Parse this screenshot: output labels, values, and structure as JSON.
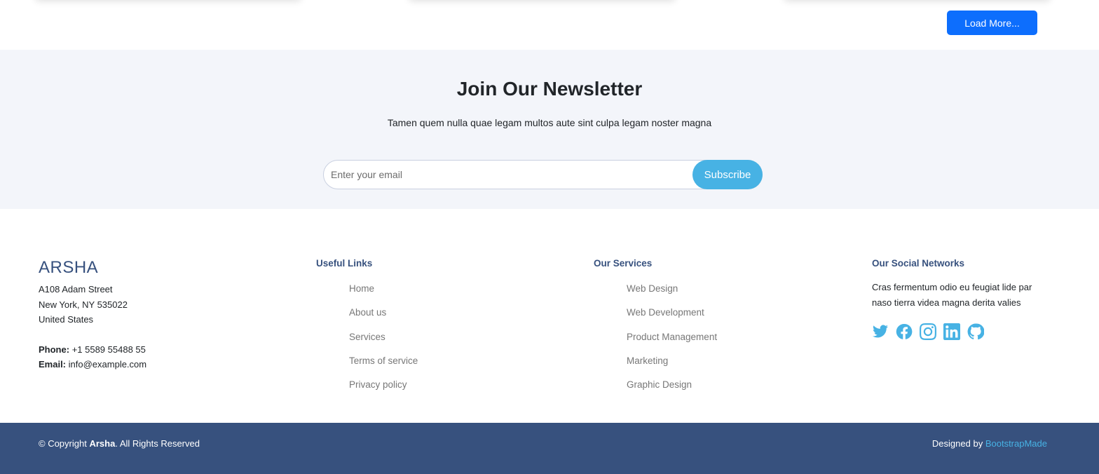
{
  "load_more": {
    "label": "Load More..."
  },
  "newsletter": {
    "title": "Join Our Newsletter",
    "subtitle": "Tamen quem nulla quae legam multos aute sint culpa legam noster magna",
    "email_placeholder": "Enter your email",
    "subscribe_label": "Subscribe"
  },
  "footer": {
    "brand": "ARSHA",
    "address": [
      "A108 Adam Street",
      "New York, NY 535022",
      "United States"
    ],
    "phone_label": "Phone:",
    "phone": "+1 5589 55488 55",
    "email_label": "Email:",
    "email": "info@example.com",
    "useful_links": {
      "title": "Useful Links",
      "items": [
        "Home",
        "About us",
        "Services",
        "Terms of service",
        "Privacy policy"
      ]
    },
    "services": {
      "title": "Our Services",
      "items": [
        "Web Design",
        "Web Development",
        "Product Management",
        "Marketing",
        "Graphic Design"
      ]
    },
    "social": {
      "title": "Our Social Networks",
      "text": "Cras fermentum odio eu feugiat lide par naso tierra videa magna derita valies",
      "icons": [
        "twitter-icon",
        "facebook-icon",
        "instagram-icon",
        "linkedin-icon",
        "github-icon"
      ]
    }
  },
  "bottom": {
    "copyright_prefix": "© Copyright",
    "copyright_brand": "Arsha",
    "copyright_suffix": ". All Rights Reserved",
    "designed_by": "Designed by",
    "designer": "BootstrapMade"
  },
  "colors": {
    "primary": "#37517e",
    "accent": "#47b2e4",
    "button_blue": "#0d6efd",
    "newsletter_bg": "#f3f5fa"
  }
}
